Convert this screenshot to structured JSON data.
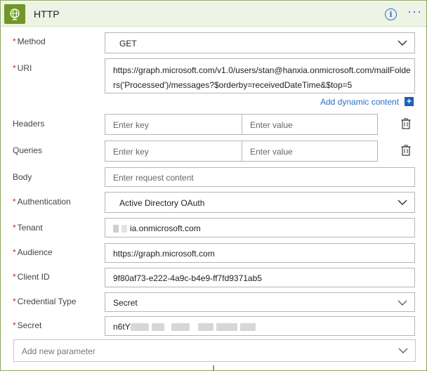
{
  "header": {
    "title": "HTTP",
    "icon": "globe-icon",
    "accent_color": "#709727",
    "info_symbol": "i",
    "more_symbol": "···"
  },
  "required_marker": "*",
  "fields": {
    "method": {
      "label": "Method",
      "value": "GET"
    },
    "uri": {
      "label": "URI",
      "line1": "https://graph.microsoft.com/v1.0/users/stan@hanxia.onmicrosoft.com/mailFolde",
      "line2": "rs('Processed')/messages?$orderby=receivedDateTime&$top=5"
    },
    "dynamic_content": {
      "label": "Add dynamic content",
      "plus": "+"
    },
    "headers": {
      "label": "Headers",
      "key_placeholder": "Enter key",
      "value_placeholder": "Enter value"
    },
    "queries": {
      "label": "Queries",
      "key_placeholder": "Enter key",
      "value_placeholder": "Enter value"
    },
    "body": {
      "label": "Body",
      "placeholder": "Enter request content"
    },
    "authentication": {
      "label": "Authentication",
      "value": "Active Directory OAuth"
    },
    "tenant": {
      "label": "Tenant",
      "value_visible": "ia.onmicrosoft.com"
    },
    "audience": {
      "label": "Audience",
      "value": "https://graph.microsoft.com"
    },
    "client_id": {
      "label": "Client ID",
      "value": "9f80af73-e222-4a9c-b4e9-ff7fd9371ab5"
    },
    "credential_type": {
      "label": "Credential Type",
      "value": "Secret"
    },
    "secret": {
      "label": "Secret",
      "value_visible": "n6tY"
    }
  },
  "add_parameter": {
    "label": "Add new parameter"
  }
}
